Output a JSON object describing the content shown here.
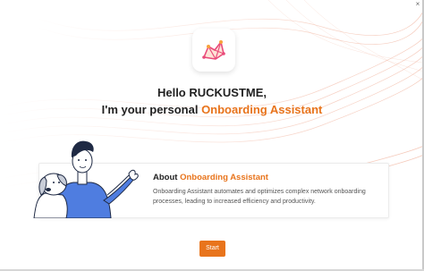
{
  "window": {
    "close_glyph": "×"
  },
  "header": {
    "hello_text": "Hello RUCKUSTME,",
    "assistant_prefix": "I'm your personal ",
    "assistant_name": "Onboarding Assistant",
    "app_icon": "onboarding-assistant-icon"
  },
  "about": {
    "title_prefix": "About ",
    "title_name": "Onboarding Assistant",
    "description": "Onboarding Assistant automates and optimizes complex network onboarding processes, leading to increased efficiency and productivity."
  },
  "actions": {
    "start_label": "Start"
  },
  "colors": {
    "accent": "#e8741c",
    "text": "#222222",
    "muted": "#555555"
  }
}
